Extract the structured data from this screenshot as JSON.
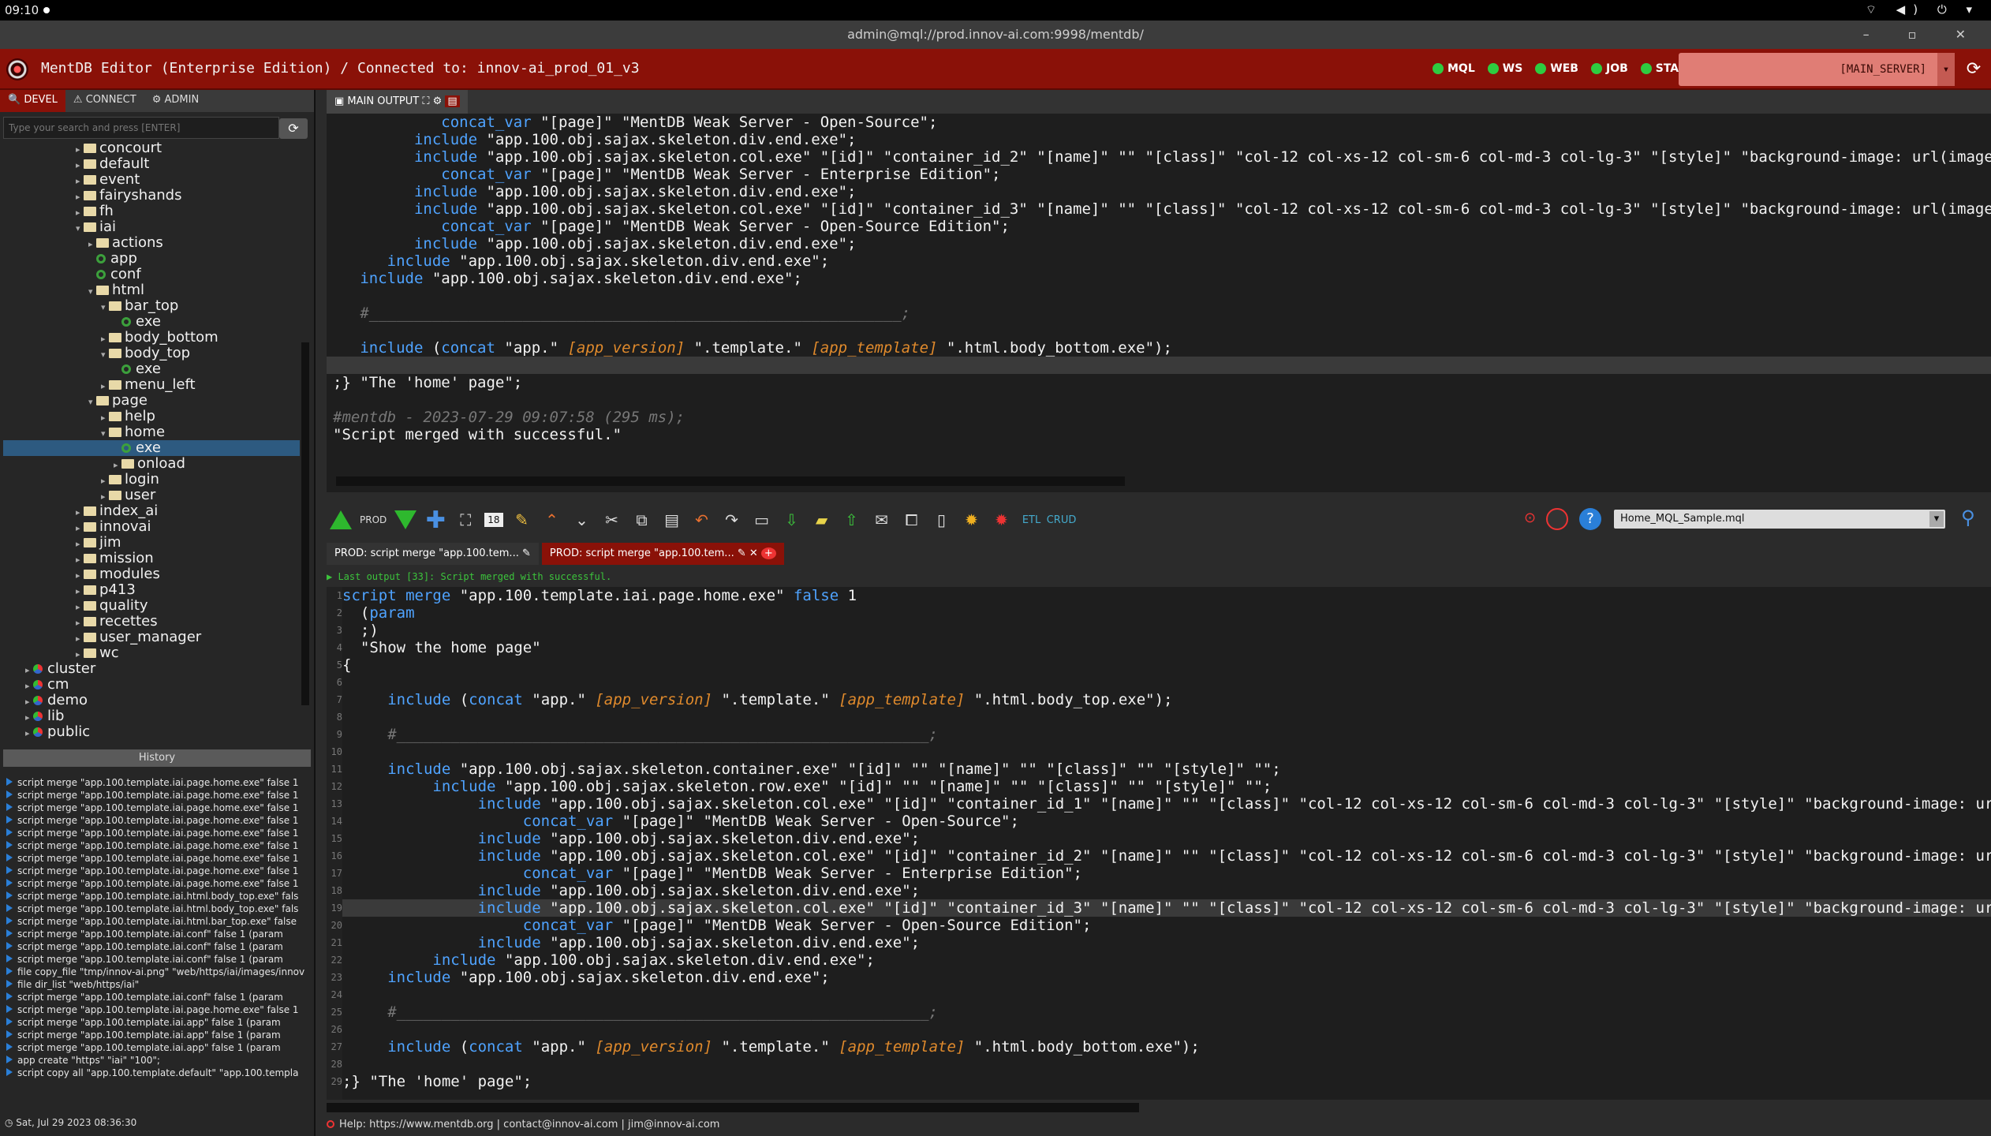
{
  "system": {
    "time": "09:10",
    "tray": "⌔ ◀) ⏻ ▾"
  },
  "window": {
    "title": "admin@mql://prod.innov-ai.com:9998/mentdb/",
    "controls": "– ▫ ✕"
  },
  "app": {
    "title": "MentDB Editor (Enterprise Edition) / Connected to: innov-ai_prod_01_v3",
    "status": [
      "MQL",
      "WS",
      "WEB",
      "JOB",
      "STACK"
    ],
    "server": "[MAIN_SERVER]",
    "accent": "#8a1108"
  },
  "left_tabs": [
    "DEVEL",
    "CONNECT",
    "ADMIN"
  ],
  "search": {
    "placeholder": "Type your search and press [ENTER]"
  },
  "tree": [
    {
      "label": "concourt",
      "icon": "folder",
      "depth": 2,
      "arrow": "▸"
    },
    {
      "label": "default",
      "icon": "folder",
      "depth": 2,
      "arrow": "▸"
    },
    {
      "label": "event",
      "icon": "folder",
      "depth": 2,
      "arrow": "▸"
    },
    {
      "label": "fairyshands",
      "icon": "folder",
      "depth": 2,
      "arrow": "▸"
    },
    {
      "label": "fh",
      "icon": "folder",
      "depth": 2,
      "arrow": "▸"
    },
    {
      "label": "iai",
      "icon": "folder",
      "depth": 2,
      "arrow": "▾"
    },
    {
      "label": "actions",
      "icon": "folder",
      "depth": 3,
      "arrow": "▸"
    },
    {
      "label": "app",
      "icon": "file",
      "depth": 3,
      "arrow": ""
    },
    {
      "label": "conf",
      "icon": "file",
      "depth": 3,
      "arrow": ""
    },
    {
      "label": "html",
      "icon": "folder",
      "depth": 3,
      "arrow": "▾"
    },
    {
      "label": "bar_top",
      "icon": "folder",
      "depth": 4,
      "arrow": "▾"
    },
    {
      "label": "exe",
      "icon": "file",
      "depth": 5,
      "arrow": ""
    },
    {
      "label": "body_bottom",
      "icon": "folder",
      "depth": 4,
      "arrow": "▸"
    },
    {
      "label": "body_top",
      "icon": "folder",
      "depth": 4,
      "arrow": "▾"
    },
    {
      "label": "exe",
      "icon": "file",
      "depth": 5,
      "arrow": ""
    },
    {
      "label": "menu_left",
      "icon": "folder",
      "depth": 4,
      "arrow": "▸"
    },
    {
      "label": "page",
      "icon": "folder",
      "depth": 3,
      "arrow": "▾"
    },
    {
      "label": "help",
      "icon": "folder",
      "depth": 4,
      "arrow": "▸"
    },
    {
      "label": "home",
      "icon": "folder",
      "depth": 4,
      "arrow": "▾"
    },
    {
      "label": "exe",
      "icon": "file",
      "depth": 5,
      "arrow": "",
      "selected": true
    },
    {
      "label": "onload",
      "icon": "folder",
      "depth": 5,
      "arrow": "▸"
    },
    {
      "label": "login",
      "icon": "folder",
      "depth": 4,
      "arrow": "▸"
    },
    {
      "label": "user",
      "icon": "folder",
      "depth": 4,
      "arrow": "▸"
    },
    {
      "label": "index_ai",
      "icon": "folder",
      "depth": 2,
      "arrow": "▸"
    },
    {
      "label": "innovai",
      "icon": "folder",
      "depth": 2,
      "arrow": "▸"
    },
    {
      "label": "jim",
      "icon": "folder",
      "depth": 2,
      "arrow": "▸"
    },
    {
      "label": "mission",
      "icon": "folder",
      "depth": 2,
      "arrow": "▸"
    },
    {
      "label": "modules",
      "icon": "folder",
      "depth": 2,
      "arrow": "▸"
    },
    {
      "label": "p413",
      "icon": "folder",
      "depth": 2,
      "arrow": "▸"
    },
    {
      "label": "quality",
      "icon": "folder",
      "depth": 2,
      "arrow": "▸"
    },
    {
      "label": "recettes",
      "icon": "folder",
      "depth": 2,
      "arrow": "▸"
    },
    {
      "label": "user_manager",
      "icon": "folder",
      "depth": 2,
      "arrow": "▸"
    },
    {
      "label": "wc",
      "icon": "folder",
      "depth": 2,
      "arrow": "▸"
    },
    {
      "label": "cluster",
      "icon": "db",
      "depth": 0,
      "arrow": "▸"
    },
    {
      "label": "cm",
      "icon": "db",
      "depth": 0,
      "arrow": "▸"
    },
    {
      "label": "demo",
      "icon": "db",
      "depth": 0,
      "arrow": "▸"
    },
    {
      "label": "lib",
      "icon": "db",
      "depth": 0,
      "arrow": "▸"
    },
    {
      "label": "public",
      "icon": "db",
      "depth": 0,
      "arrow": "▸"
    }
  ],
  "history": {
    "title": "History",
    "items": [
      "script merge \"app.100.template.iai.page.home.exe\" false 1",
      "script merge \"app.100.template.iai.page.home.exe\" false 1",
      "script merge \"app.100.template.iai.page.home.exe\" false 1",
      "script merge \"app.100.template.iai.page.home.exe\" false 1",
      "script merge \"app.100.template.iai.page.home.exe\" false 1",
      "script merge \"app.100.template.iai.page.home.exe\" false 1",
      "script merge \"app.100.template.iai.page.home.exe\" false 1",
      "script merge \"app.100.template.iai.page.home.exe\" false 1",
      "script merge \"app.100.template.iai.page.home.exe\" false 1",
      "script merge \"app.100.template.iai.html.body_top.exe\" fals",
      "script merge \"app.100.template.iai.html.body_top.exe\" fals",
      "script merge \"app.100.template.iai.html.bar_top.exe\" false",
      "script merge \"app.100.template.iai.conf\" false 1   (param",
      "script merge \"app.100.template.iai.conf\" false 1   (param",
      "script merge \"app.100.template.iai.conf\" false 1   (param",
      "file copy_file \"tmp/innov-ai.png\" \"web/https/iai/images/innov",
      "file dir_list \"web/https/iai\"",
      "script merge \"app.100.template.iai.conf\" false 1   (param",
      "script merge \"app.100.template.iai.page.home.exe\" false 1",
      "script merge \"app.100.template.iai.app\" false 1   (param",
      "script merge \"app.100.template.iai.app\" false 1   (param",
      "script merge \"app.100.template.iai.app\" false 1   (param",
      "app create \"https\" \"iai\" \"100\";",
      "script copy all \"app.100.template.default\" \"app.100.templa"
    ]
  },
  "clock": "Sat, Jul 29 2023 08:36:30",
  "output_tab": "MAIN OUTPUT",
  "output_lines": [
    "            <span class='kw'>concat_var</span> \"[page]\" \"MentDB Weak Server - Open-Source\";",
    "         <span class='kw'>include</span> \"app.100.obj.sajax.skeleton.div.end.exe\";",
    "         <span class='kw'>include</span> \"app.100.obj.sajax.skeleton.col.exe\" \"[id]\" \"container_id_2\" \"[name]\" \"\" \"[class]\" \"col-12 col-xs-12 col-sm-6 col-md-3 col-lg-3\" \"[style]\" \"background-image: url(image",
    "            <span class='kw'>concat_var</span> \"[page]\" \"MentDB Weak Server - Enterprise Edition\";",
    "         <span class='kw'>include</span> \"app.100.obj.sajax.skeleton.div.end.exe\";",
    "         <span class='kw'>include</span> \"app.100.obj.sajax.skeleton.col.exe\" \"[id]\" \"container_id_3\" \"[name]\" \"\" \"[class]\" \"col-12 col-xs-12 col-sm-6 col-md-3 col-lg-3\" \"[style]\" \"background-image: url(image",
    "            <span class='kw'>concat_var</span> \"[page]\" \"MentDB Weak Server - Open-Source Edition\";",
    "         <span class='kw'>include</span> \"app.100.obj.sajax.skeleton.div.end.exe\";",
    "      <span class='kw'>include</span> \"app.100.obj.sajax.skeleton.div.end.exe\";",
    "   <span class='kw'>include</span> \"app.100.obj.sajax.skeleton.div.end.exe\";",
    "",
    "   <span class='cm'>#___________________________________________________________;</span>",
    "",
    "   <span class='kw'>include</span> (<span class='kw'>concat</span> \"app.\" <span class='va'>[app_version]</span> \".template.\" <span class='va'>[app_template]</span> \".html.body_bottom.exe\");",
    "",
    ";} \"The 'home' page\";",
    "",
    "<span class='cm'>#mentdb - 2023-07-29 09:07:58 (295 ms);</span>",
    "\"Script merged with successful.\""
  ],
  "toolbar": {
    "env": "PROD",
    "counter": "18",
    "file": "Home_MQL_Sample.mql"
  },
  "editor_tabs": [
    "PROD: script merge \"app.100.tem...",
    "PROD: script merge \"app.100.tem..."
  ],
  "last_output": "Last output [33]: Script merged with successful.",
  "editor_lines": [
    "<span class='kw'>script merge</span> \"app.100.template.iai.page.home.exe\" <span class='kw'>false</span> 1",
    "  (<span class='kw'>param</span>",
    "  ;)",
    "  \"Show the home page\"",
    "{",
    "",
    "     <span class='kw'>include</span> (<span class='kw'>concat</span> \"app.\" <span class='va'>[app_version]</span> \".template.\" <span class='va'>[app_template]</span> \".html.body_top.exe\");",
    "",
    "     <span class='cm'>#___________________________________________________________;</span>",
    "",
    "     <span class='kw'>include</span> \"app.100.obj.sajax.skeleton.container.exe\" \"[id]\" \"\" \"[name]\" \"\" \"[class]\" \"\" \"[style]\" \"\";",
    "          <span class='kw'>include</span> \"app.100.obj.sajax.skeleton.row.exe\" \"[id]\" \"\" \"[name]\" \"\" \"[class]\" \"\" \"[style]\" \"\";",
    "               <span class='kw'>include</span> \"app.100.obj.sajax.skeleton.col.exe\" \"[id]\" \"container_id_1\" \"[name]\" \"\" \"[class]\" \"col-12 col-xs-12 col-sm-6 col-md-3 col-lg-3\" \"[style]\" \"background-image: url(ima",
    "                    <span class='kw'>concat_var</span> \"[page]\" \"MentDB Weak Server - Open-Source\";",
    "               <span class='kw'>include</span> \"app.100.obj.sajax.skeleton.div.end.exe\";",
    "               <span class='kw'>include</span> \"app.100.obj.sajax.skeleton.col.exe\" \"[id]\" \"container_id_2\" \"[name]\" \"\" \"[class]\" \"col-12 col-xs-12 col-sm-6 col-md-3 col-lg-3\" \"[style]\" \"background-image: url(ima",
    "                    <span class='kw'>concat_var</span> \"[page]\" \"MentDB Weak Server - Enterprise Edition\";",
    "               <span class='kw'>include</span> \"app.100.obj.sajax.skeleton.div.end.exe\";",
    "               <span class='kw'>include</span> \"app.100.obj.sajax.skeleton.col.exe\" \"[id]\" \"container_id_3\" \"[name]\" \"\" \"[class]\" \"col-12 col-xs-12 col-sm-6 col-md-3 col-lg-3\" \"[style]\" \"background-image: url(ima",
    "                    <span class='kw'>concat_var</span> \"[page]\" \"MentDB Weak Server - Open-Source Edition\";",
    "               <span class='kw'>include</span> \"app.100.obj.sajax.skeleton.div.end.exe\";",
    "          <span class='kw'>include</span> \"app.100.obj.sajax.skeleton.div.end.exe\";",
    "     <span class='kw'>include</span> \"app.100.obj.sajax.skeleton.div.end.exe\";",
    "",
    "     <span class='cm'>#___________________________________________________________;</span>",
    "",
    "     <span class='kw'>include</span> (<span class='kw'>concat</span> \"app.\" <span class='va'>[app_version]</span> \".template.\" <span class='va'>[app_template]</span> \".html.body_bottom.exe\");",
    "",
    ";} \"The 'home' page\";"
  ],
  "help": "Help: https://www.mentdb.org | contact@innov-ai.com | jim@innov-ai.com"
}
